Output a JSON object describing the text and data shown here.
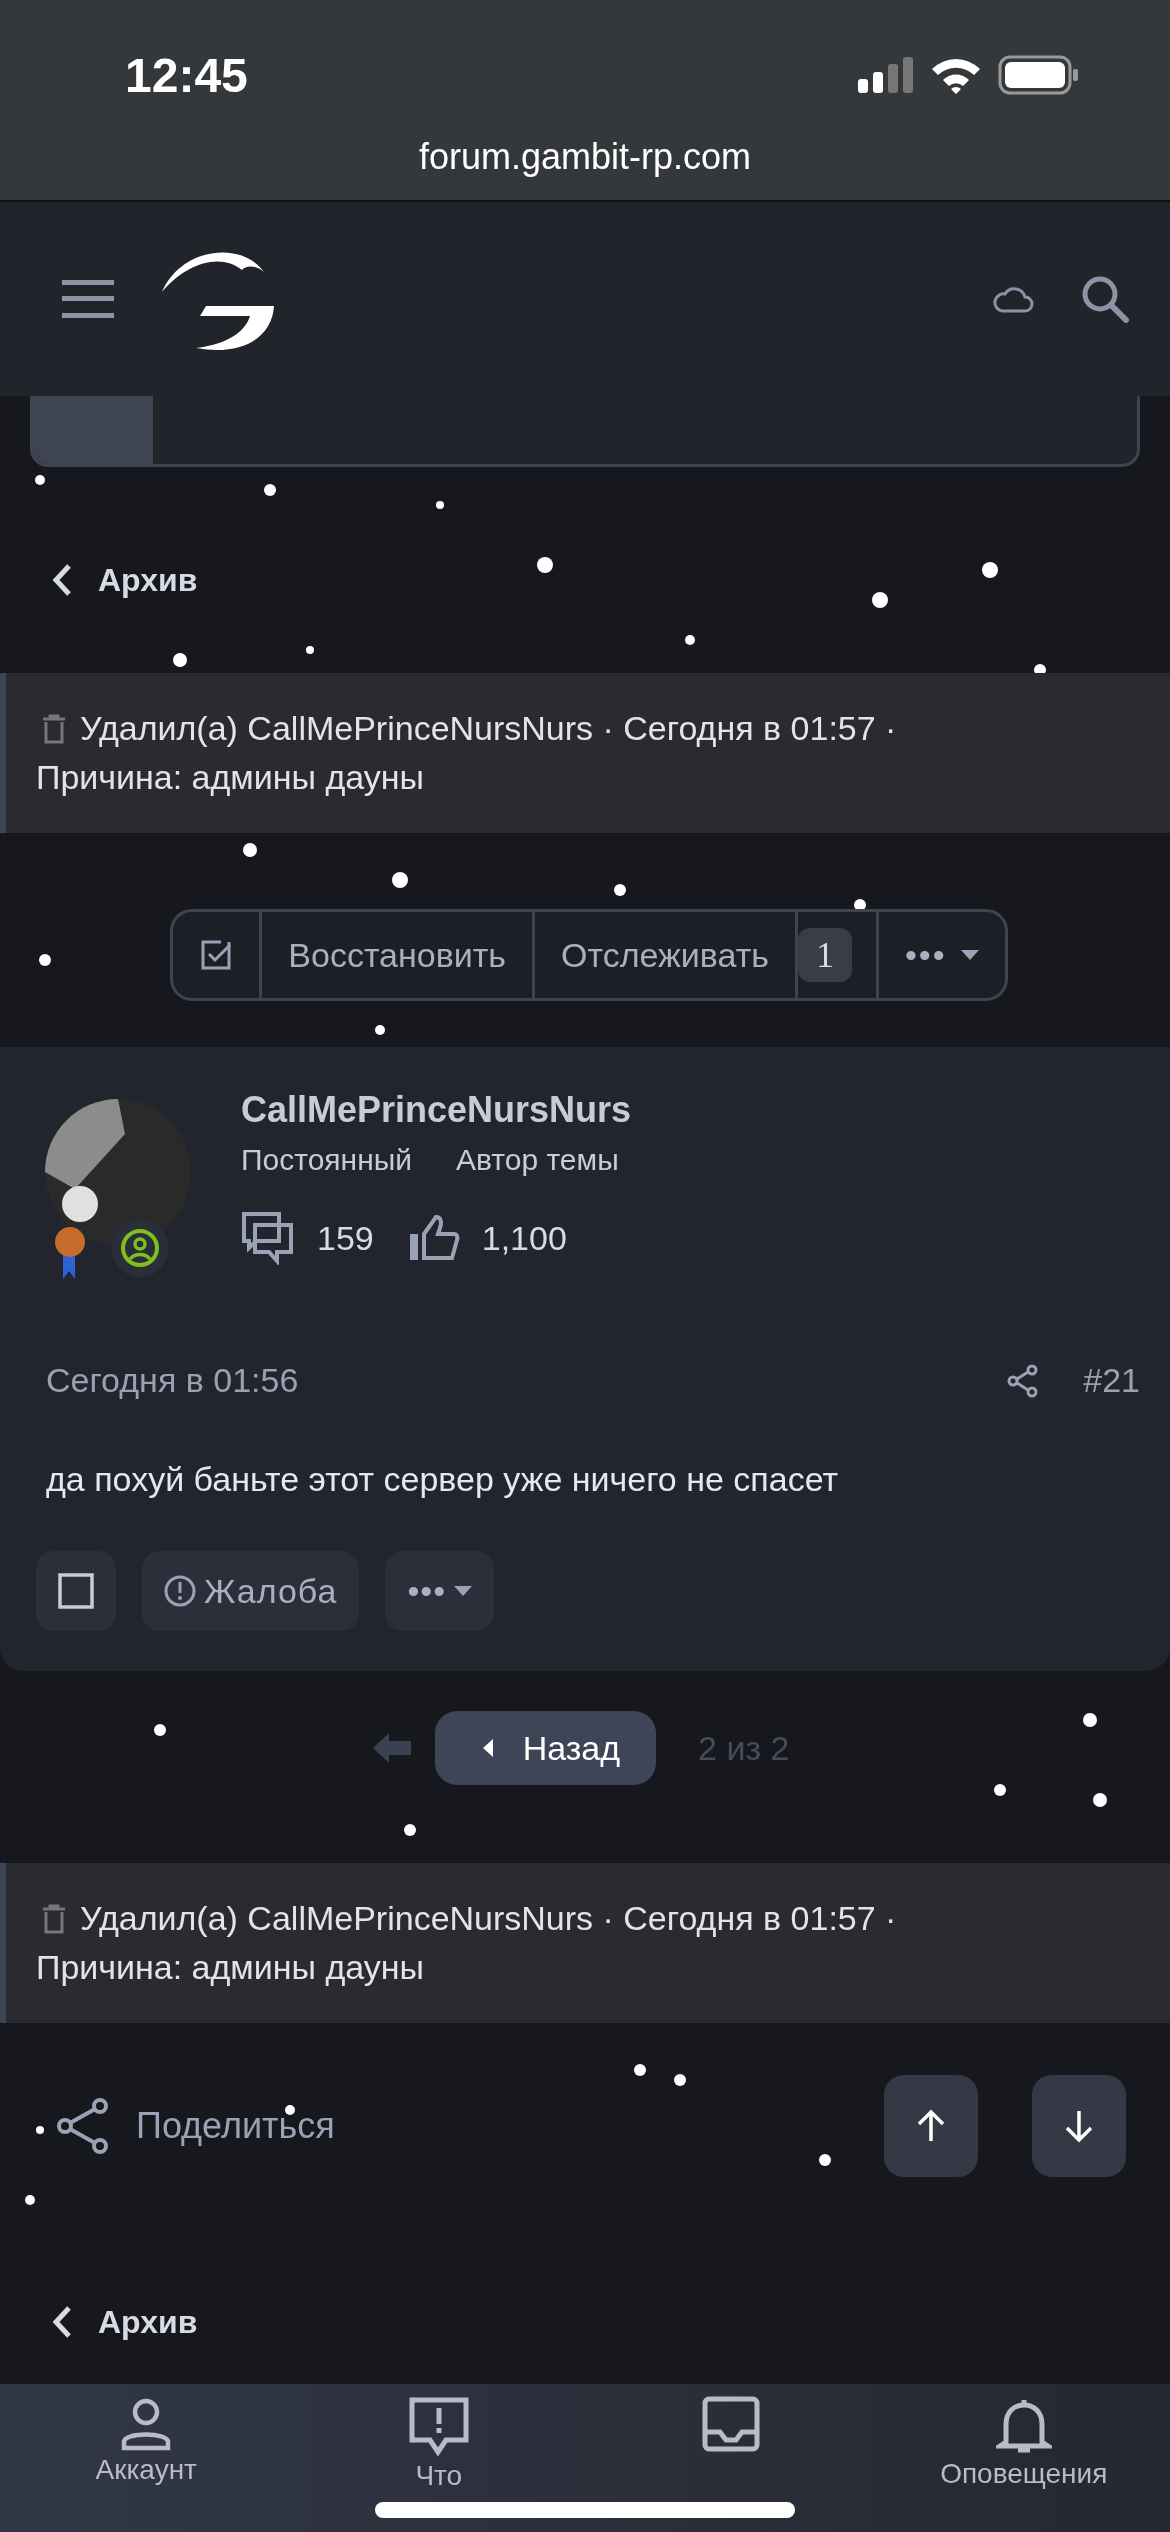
{
  "status_bar": {
    "time": "12:45"
  },
  "browser": {
    "url": "forum.gambit-rp.com"
  },
  "breadcrumb": {
    "label": "Архив"
  },
  "top_notice": {
    "text": "Удалил(а) CallMePrinceNursNurs · Сегодня в 01:57 ·",
    "reason": "Причина: админы дауны"
  },
  "toolbar": {
    "restore": "Восстановить",
    "watch": "Отслеживать",
    "watch_count": "1",
    "more": "•••"
  },
  "post": {
    "author": "CallMePrinceNursNurs",
    "user_title": "Постоянный",
    "role": "Автор темы",
    "messages": "159",
    "likes": "1,100",
    "time": "Сегодня в 01:56",
    "number": "#21",
    "body": "да похуй баньте этот сервер уже ничего не спасет",
    "checked": false,
    "report": "Жалоба",
    "more": "•••"
  },
  "pager": {
    "back": "Назад",
    "position": "2 из 2"
  },
  "bottom_notice": {
    "text": "Удалил(а) CallMePrinceNursNurs · Сегодня в 01:57 ·",
    "reason": "Причина: админы дауны"
  },
  "share": "Поделиться",
  "footer_breadcrumb": {
    "label": "Архив"
  },
  "tabs": [
    {
      "kind": "account",
      "label": "Аккаунт"
    },
    {
      "kind": "news",
      "label": "Что"
    },
    {
      "kind": "inbox"
    },
    {
      "kind": "alerts",
      "label": "Оповещения"
    }
  ]
}
